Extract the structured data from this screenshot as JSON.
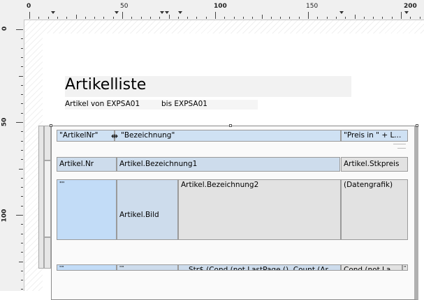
{
  "rulers": {
    "top_labels": [
      "0",
      "50",
      "100",
      "150",
      "200"
    ],
    "left_labels": [
      "0",
      "50",
      "100"
    ]
  },
  "report": {
    "title": "Artikelliste",
    "subtitle_from": "Artikel von EXPSA01",
    "subtitle_to": "bis EXPSA01"
  },
  "header_row": {
    "artikelnr": "\"ArtikelNr\"",
    "bezeichnung": "\"Bezeichnung\"",
    "preis": "\"Preis in \" + L..."
  },
  "data_row": {
    "nr": "Artikel.Nr",
    "bez1": "Artikel.Bezeichnung1",
    "stk": "Artikel.Stkpreis"
  },
  "detail_row": {
    "empty1": "\"\"",
    "bild": "Artikel.Bild",
    "bez2": "Artikel.Bezeichnung2",
    "grafik": "(Datengrafik)"
  },
  "footer_row": {
    "empty1": "\"\"",
    "empty2": "\"\"",
    "strcond": "Str$ (Cond (not LastPage (), Count (Ar",
    "cond": "Cond (not La",
    "edge": "\""
  },
  "colors": {
    "ruler_bg": "#f0f0f0",
    "blue_field": "#cfe1f3",
    "grey_field": "#e2e2e2"
  }
}
